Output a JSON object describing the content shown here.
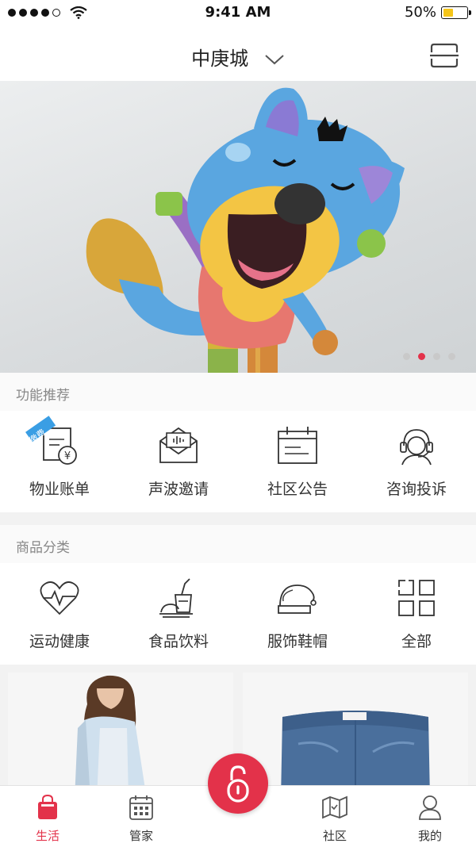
{
  "status": {
    "time": "9:41 AM",
    "battery": "50%",
    "battery_level": 0.5
  },
  "header": {
    "title": "中庚城"
  },
  "banner": {
    "pages": 4,
    "active_page": 2
  },
  "features": {
    "title": "功能推荐",
    "badge": "缴费",
    "items": [
      {
        "label": "物业账单",
        "icon": "bill-icon"
      },
      {
        "label": "声波邀请",
        "icon": "sound-invite-icon"
      },
      {
        "label": "社区公告",
        "icon": "notice-board-icon"
      },
      {
        "label": "咨询投诉",
        "icon": "customer-service-icon"
      }
    ]
  },
  "categories": {
    "title": "商品分类",
    "items": [
      {
        "label": "运动健康",
        "icon": "heartbeat-icon"
      },
      {
        "label": "食品饮料",
        "icon": "drink-icon"
      },
      {
        "label": "服饰鞋帽",
        "icon": "hat-icon"
      },
      {
        "label": "全部",
        "icon": "grid-icon"
      }
    ]
  },
  "tabbar": {
    "items": [
      {
        "label": "生活",
        "icon": "shopping-bag-icon",
        "active": true
      },
      {
        "label": "管家",
        "icon": "calendar-icon",
        "active": false
      },
      {
        "label": "社区",
        "icon": "map-icon",
        "active": false
      },
      {
        "label": "我的",
        "icon": "user-icon",
        "active": false
      }
    ],
    "center_icon": "unlock-icon"
  },
  "colors": {
    "accent": "#e3324a",
    "battery": "#f5c518"
  }
}
